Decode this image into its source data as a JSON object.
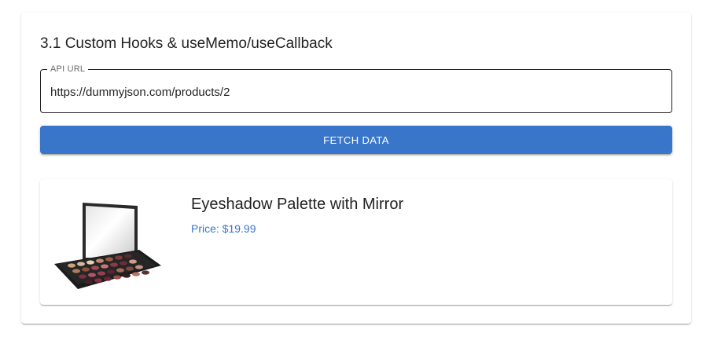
{
  "section": {
    "title": "3.1 Custom Hooks & useMemo/useCallback"
  },
  "api_field": {
    "label": "API URL",
    "value": "https://dummyjson.com/products/2"
  },
  "fetch_button": {
    "label": "FETCH DATA"
  },
  "product": {
    "title": "Eyeshadow Palette with Mirror",
    "price_text": "Price: $19.99",
    "image_alt": "eyeshadow-palette-image"
  },
  "colors": {
    "accent": "#3976c9",
    "text_primary": "rgba(0,0,0,0.87)"
  }
}
